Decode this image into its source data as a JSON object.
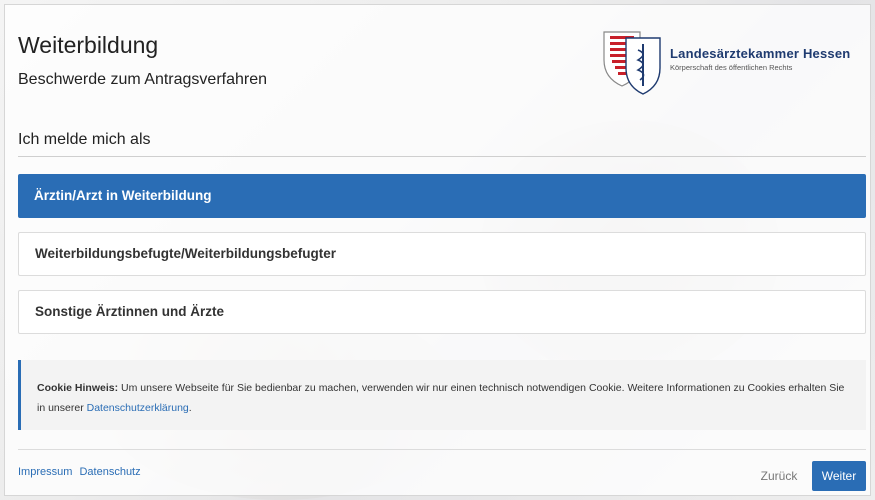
{
  "header": {
    "title": "Weiterbildung",
    "subtitle": "Beschwerde zum Antragsverfahren"
  },
  "logo": {
    "name": "Landesärztekammer Hessen",
    "tagline": "Körperschaft des öffentlichen Rechts"
  },
  "section": {
    "heading": "Ich melde mich als"
  },
  "roles": [
    {
      "label": "Ärztin/Arzt in Weiterbildung",
      "selected": true
    },
    {
      "label": "Weiterbildungsbefugte/Weiterbildungsbefugter",
      "selected": false
    },
    {
      "label": "Sonstige Ärztinnen und Ärzte",
      "selected": false
    }
  ],
  "cookie": {
    "label": "Cookie Hinweis:",
    "text": "Um unsere Webseite für Sie bedienbar zu machen, verwenden wir nur einen technisch notwendigen Cookie. Weitere Informationen zu Cookies erhalten Sie in unserer",
    "link": "Datenschutzerklärung",
    "end": "."
  },
  "footer": {
    "impressum": "Impressum",
    "datenschutz": "Datenschutz",
    "back": "Zurück",
    "next": "Weiter"
  },
  "colors": {
    "accent": "#2a6db5",
    "logo_text": "#1f3b70",
    "crest_red": "#c8202a"
  },
  "icons": [
    "hessen-crest-icon",
    "caduceus-shield-icon"
  ]
}
